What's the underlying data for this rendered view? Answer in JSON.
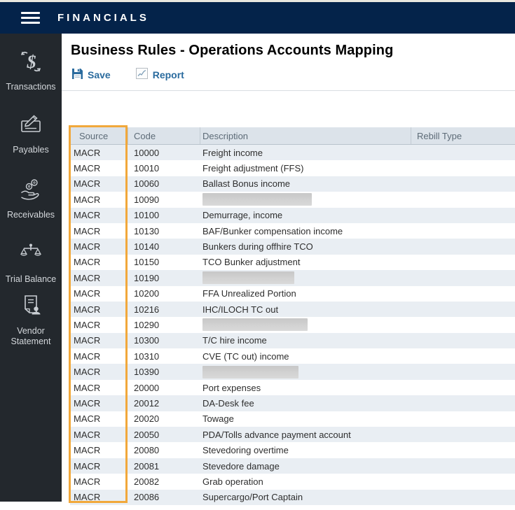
{
  "app_bar": {
    "title": "FINANCIALS"
  },
  "sidebar": {
    "items": [
      {
        "label": "Transactions",
        "icon": "transactions-icon"
      },
      {
        "label": "Payables",
        "icon": "payables-icon"
      },
      {
        "label": "Receivables",
        "icon": "receivables-icon"
      },
      {
        "label": "Trial Balance",
        "icon": "trial-balance-icon"
      },
      {
        "label": "Vendor Statement",
        "icon": "vendor-statement-icon"
      }
    ]
  },
  "page": {
    "title": "Business Rules - Operations Accounts Mapping"
  },
  "toolbar": {
    "save_label": "Save",
    "report_label": "Report"
  },
  "table": {
    "columns": [
      "Source",
      "Code",
      "Description",
      "Rebill Type"
    ],
    "highlighted_column": "Source",
    "rows": [
      {
        "source": "MACR",
        "code": "10000",
        "description": "Freight income",
        "rebill": "",
        "redacted": false
      },
      {
        "source": "MACR",
        "code": "10010",
        "description": "Freight adjustment (FFS)",
        "rebill": "",
        "redacted": false
      },
      {
        "source": "MACR",
        "code": "10060",
        "description": "Ballast Bonus income",
        "rebill": "",
        "redacted": false
      },
      {
        "source": "MACR",
        "code": "10090",
        "description": "",
        "rebill": "",
        "redacted": true,
        "redact_width": 156
      },
      {
        "source": "MACR",
        "code": "10100",
        "description": "Demurrage, income",
        "rebill": "",
        "redacted": false
      },
      {
        "source": "MACR",
        "code": "10130",
        "description": "BAF/Bunker compensation income",
        "rebill": "",
        "redacted": false
      },
      {
        "source": "MACR",
        "code": "10140",
        "description": "Bunkers during offhire TCO",
        "rebill": "",
        "redacted": false
      },
      {
        "source": "MACR",
        "code": "10150",
        "description": "TCO Bunker adjustment",
        "rebill": "",
        "redacted": false
      },
      {
        "source": "MACR",
        "code": "10190",
        "description": "",
        "rebill": "",
        "redacted": true,
        "redact_width": 131
      },
      {
        "source": "MACR",
        "code": "10200",
        "description": "FFA Unrealized Portion",
        "rebill": "",
        "redacted": false
      },
      {
        "source": "MACR",
        "code": "10216",
        "description": "IHC/ILOCH TC out",
        "rebill": "",
        "redacted": false
      },
      {
        "source": "MACR",
        "code": "10290",
        "description": "",
        "rebill": "",
        "redacted": true,
        "redact_width": 150
      },
      {
        "source": "MACR",
        "code": "10300",
        "description": "T/C hire income",
        "rebill": "",
        "redacted": false
      },
      {
        "source": "MACR",
        "code": "10310",
        "description": "CVE (TC out) income",
        "rebill": "",
        "redacted": false
      },
      {
        "source": "MACR",
        "code": "10390",
        "description": "",
        "rebill": "",
        "redacted": true,
        "redact_width": 137
      },
      {
        "source": "MACR",
        "code": "20000",
        "description": "Port expenses",
        "rebill": "",
        "redacted": false
      },
      {
        "source": "MACR",
        "code": "20012",
        "description": "DA-Desk fee",
        "rebill": "",
        "redacted": false
      },
      {
        "source": "MACR",
        "code": "20020",
        "description": "Towage",
        "rebill": "",
        "redacted": false
      },
      {
        "source": "MACR",
        "code": "20050",
        "description": "PDA/Tolls advance payment account",
        "rebill": "",
        "redacted": false
      },
      {
        "source": "MACR",
        "code": "20080",
        "description": "Stevedoring overtime",
        "rebill": "",
        "redacted": false
      },
      {
        "source": "MACR",
        "code": "20081",
        "description": "Stevedore damage",
        "rebill": "",
        "redacted": false
      },
      {
        "source": "MACR",
        "code": "20082",
        "description": "Grab operation",
        "rebill": "",
        "redacted": false
      },
      {
        "source": "MACR",
        "code": "20086",
        "description": "Supercargo/Port Captain",
        "rebill": "",
        "redacted": false
      }
    ]
  },
  "colors": {
    "appbar_navy": "#04234a",
    "sidebar_bg": "#23282d",
    "accent_orange": "#f1a83b",
    "button_blue": "#2a6b9e",
    "table_header_bg": "#dce3ea",
    "row_alt_bg": "#e9eef3"
  }
}
